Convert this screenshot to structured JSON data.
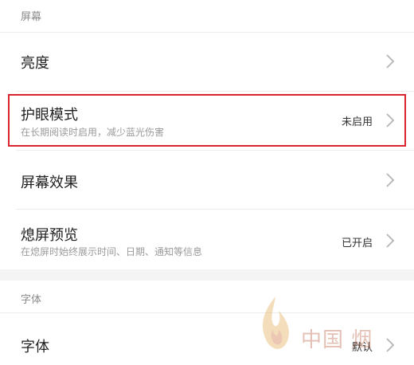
{
  "sections": {
    "screen_header": "屏幕",
    "font_header": "字体"
  },
  "rows": {
    "brightness": {
      "title": "亮度"
    },
    "eye_protection": {
      "title": "护眼模式",
      "subtitle": "在长期阅读时启用，减少蓝光伤害",
      "value": "未启用"
    },
    "screen_effect": {
      "title": "屏幕效果"
    },
    "lockscreen_preview": {
      "title": "熄屏预览",
      "subtitle": "在熄屏时始终展示时间、日期、通知等信息",
      "value": "已开启"
    },
    "font": {
      "title": "字体",
      "value": "默认"
    }
  },
  "watermark": {
    "text": "中国 烟"
  },
  "colors": {
    "highlight_border": "#d9232d",
    "section_gap": "#f4f4f4"
  },
  "icons": {
    "chevron": "chevron-right-icon",
    "watermark_logo": "flame-logo"
  }
}
